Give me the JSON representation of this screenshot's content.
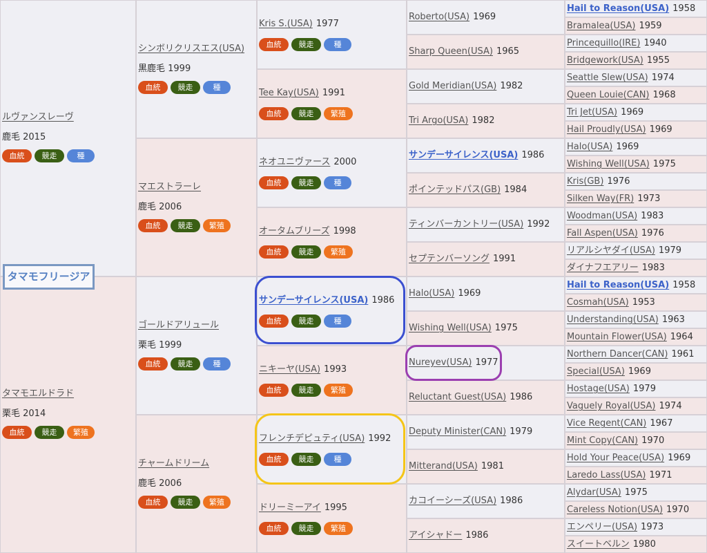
{
  "horse": {
    "name": "タマモフリージア"
  },
  "parents": [
    {
      "name": "ルヴァンスレーヴ",
      "details": "鹿毛 2015",
      "badges": [
        "血統",
        "競走",
        "種"
      ],
      "children": [
        {
          "name": "シンボリクリスエス(USA)",
          "details": "黒鹿毛 1999",
          "badges": [
            "血統",
            "競走",
            "種"
          ],
          "children": [
            {
              "name": "Kris S.(USA)",
              "year": "1977",
              "badges": [
                "血統",
                "競走",
                "種"
              ],
              "children": [
                {
                  "name": "Roberto(USA)",
                  "year": "1969"
                },
                {
                  "name": "Sharp Queen(USA)",
                  "year": "1965"
                }
              ]
            },
            {
              "name": "Tee Kay(USA)",
              "year": "1991",
              "badges": [
                "血統",
                "競走",
                "繁殖"
              ],
              "children": [
                {
                  "name": "Gold Meridian(USA)",
                  "year": "1982"
                },
                {
                  "name": "Tri Argo(USA)",
                  "year": "1982"
                }
              ]
            }
          ]
        },
        {
          "name": "マエストラーレ",
          "details": "鹿毛 2006",
          "badges": [
            "血統",
            "競走",
            "繁殖"
          ],
          "children": [
            {
              "name": "ネオユニヴァース",
              "year": "2000",
              "badges": [
                "血統",
                "競走",
                "種"
              ],
              "children": [
                {
                  "name": "サンデーサイレンス(USA)",
                  "year": "1986"
                },
                {
                  "name": "ポインテッドパス(GB)",
                  "year": "1984"
                }
              ]
            },
            {
              "name": "オータムブリーズ",
              "year": "1998",
              "badges": [
                "血統",
                "競走",
                "繁殖"
              ],
              "children": [
                {
                  "name": "ティンバーカントリー(USA)",
                  "year": "1992"
                },
                {
                  "name": "セプテンバーソング",
                  "year": "1991"
                }
              ]
            }
          ]
        }
      ]
    },
    {
      "name": "タマモエルドラド",
      "details": "栗毛 2014",
      "badges": [
        "血統",
        "競走",
        "繁殖"
      ],
      "children": [
        {
          "name": "ゴールドアリュール",
          "details": "栗毛 1999",
          "badges": [
            "血統",
            "競走",
            "種"
          ],
          "children": [
            {
              "name": "サンデーサイレンス(USA)",
              "year": "1986",
              "badges": [
                "血統",
                "競走",
                "種"
              ],
              "children": [
                {
                  "name": "Halo(USA)",
                  "year": "1969"
                },
                {
                  "name": "Wishing Well(USA)",
                  "year": "1975"
                }
              ]
            },
            {
              "name": "ニキーヤ(USA)",
              "year": "1993",
              "badges": [
                "血統",
                "競走",
                "繁殖"
              ],
              "children": [
                {
                  "name": "Nureyev(USA)",
                  "year": "1977"
                },
                {
                  "name": "Reluctant Guest(USA)",
                  "year": "1986"
                }
              ]
            }
          ]
        },
        {
          "name": "チャームドリーム",
          "details": "鹿毛 2006",
          "badges": [
            "血統",
            "競走",
            "繁殖"
          ],
          "children": [
            {
              "name": "フレンチデピュティ(USA)",
              "year": "1992",
              "badges": [
                "血統",
                "競走",
                "種"
              ],
              "children": [
                {
                  "name": "Deputy Minister(CAN)",
                  "year": "1979"
                },
                {
                  "name": "Mitterand(USA)",
                  "year": "1981"
                }
              ]
            },
            {
              "name": "ドリーミーアイ",
              "year": "1995",
              "badges": [
                "血統",
                "競走",
                "繁殖"
              ],
              "children": [
                {
                  "name": "カコイーシーズ(USA)",
                  "year": "1986"
                },
                {
                  "name": "アイシャドー",
                  "year": "1986"
                }
              ]
            }
          ]
        }
      ]
    }
  ],
  "fifth_generation": [
    {
      "name": "Hail to Reason(USA)",
      "year": "1958"
    },
    {
      "name": "Bramalea(USA)",
      "year": "1959"
    },
    {
      "name": "Princequillo(IRE)",
      "year": "1940"
    },
    {
      "name": "Bridgework(USA)",
      "year": "1955"
    },
    {
      "name": "Seattle Slew(USA)",
      "year": "1974"
    },
    {
      "name": "Queen Louie(CAN)",
      "year": "1968"
    },
    {
      "name": "Tri Jet(USA)",
      "year": "1969"
    },
    {
      "name": "Hail Proudly(USA)",
      "year": "1969"
    },
    {
      "name": "Halo(USA)",
      "year": "1969"
    },
    {
      "name": "Wishing Well(USA)",
      "year": "1975"
    },
    {
      "name": "Kris(GB)",
      "year": "1976"
    },
    {
      "name": "Silken Way(FR)",
      "year": "1973"
    },
    {
      "name": "Woodman(USA)",
      "year": "1983"
    },
    {
      "name": "Fall Aspen(USA)",
      "year": "1976"
    },
    {
      "name": "リアルシヤダイ(USA)",
      "year": "1979"
    },
    {
      "name": "ダイナフエアリー",
      "year": "1983"
    },
    {
      "name": "Hail to Reason(USA)",
      "year": "1958"
    },
    {
      "name": "Cosmah(USA)",
      "year": "1953"
    },
    {
      "name": "Understanding(USA)",
      "year": "1963"
    },
    {
      "name": "Mountain Flower(USA)",
      "year": "1964"
    },
    {
      "name": "Northern Dancer(CAN)",
      "year": "1961"
    },
    {
      "name": "Special(USA)",
      "year": "1969"
    },
    {
      "name": "Hostage(USA)",
      "year": "1979"
    },
    {
      "name": "Vaguely Royal(USA)",
      "year": "1974"
    },
    {
      "name": "Vice Regent(CAN)",
      "year": "1967"
    },
    {
      "name": "Mint Copy(CAN)",
      "year": "1970"
    },
    {
      "name": "Hold Your Peace(USA)",
      "year": "1969"
    },
    {
      "name": "Laredo Lass(USA)",
      "year": "1971"
    },
    {
      "name": "Alydar(USA)",
      "year": "1975"
    },
    {
      "name": "Careless Notion(USA)",
      "year": "1970"
    },
    {
      "name": "エンペリー(USA)",
      "year": "1973"
    },
    {
      "name": "スイートベルン",
      "year": "1980"
    }
  ],
  "highlighted_names": [
    "Hail to Reason(USA)",
    "サンデーサイレンス(USA)"
  ],
  "badge_colors": {
    "血統": "#d94f1b",
    "競走": "#3a5f14",
    "種": "#5585d8",
    "繁殖": "#ee731f"
  },
  "annotations": [
    {
      "target": "サンデーサイレンス(USA) 1986 (gen 3)",
      "color": "#3b4fd0"
    },
    {
      "target": "Nureyev(USA) 1977",
      "color": "#9b3fb0"
    },
    {
      "target": "フレンチデピュティ(USA) 1992",
      "color": "#f5c518"
    }
  ]
}
